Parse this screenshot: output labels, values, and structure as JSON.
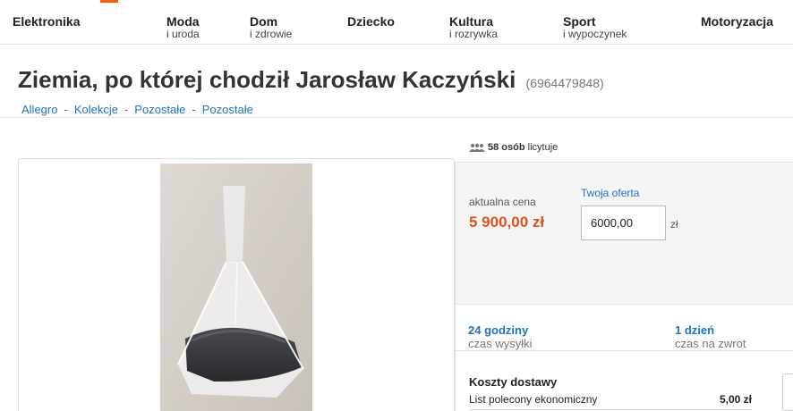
{
  "nav": {
    "categories": [
      {
        "main": "Elektronika",
        "sub": ""
      },
      {
        "main": "Moda",
        "sub": "i uroda"
      },
      {
        "main": "Dom",
        "sub": "i zdrowie"
      },
      {
        "main": "Dziecko",
        "sub": ""
      },
      {
        "main": "Kultura",
        "sub": "i rozrywka"
      },
      {
        "main": "Sport",
        "sub": "i wypoczynek"
      },
      {
        "main": "Motoryzacja",
        "sub": ""
      }
    ]
  },
  "item": {
    "title": "Ziemia, po której chodził Jarosław Kaczyński",
    "id": "(6964479848)"
  },
  "breadcrumb": [
    "Allegro",
    "Kolekcje",
    "Pozostałe",
    "Pozostałe"
  ],
  "watchers": {
    "count": "58 osób",
    "suffix": "licytuje"
  },
  "bid": {
    "price_label": "aktualna cena",
    "price": "5 900,00 zł",
    "offer_label": "Twoja oferta",
    "offer_value": "6000,00",
    "currency": "zł"
  },
  "shipping": {
    "dispatch_value": "24 godziny",
    "dispatch_label": "czas wysyłki",
    "return_value": "1 dzień",
    "return_label": "czas na zwrot"
  },
  "costs": {
    "title": "Koszty dostawy",
    "method": "List polecony ekonomiczny",
    "amount": "5,00 zł"
  },
  "colors": {
    "accent": "#ff5a00",
    "price": "#e4501a",
    "link": "#1e73be"
  }
}
